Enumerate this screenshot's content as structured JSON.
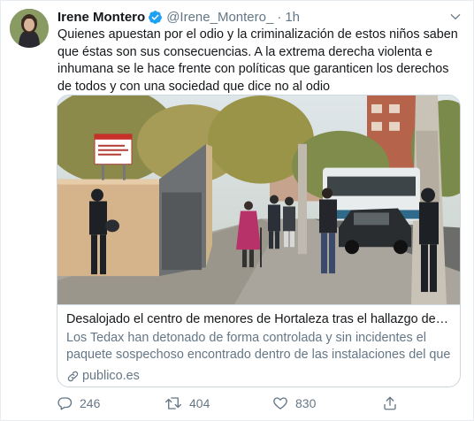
{
  "tweet": {
    "display_name": "Irene Montero",
    "handle": "@Irene_Montero_",
    "separator": "·",
    "time": "1h",
    "text": "Quienes apuestan por el odio y la criminalización de estos niños saben que éstas son sus consecuencias. A la extrema derecha violenta e inhumana se le hace frente con políticas que garanticen los derechos de todos y con una sociedad que dice no al odio"
  },
  "card": {
    "title": "Desalojado el centro de menores de Hortaleza tras el hallazgo de un art…",
    "description": "Los Tedax han detonado de forma controlada y sin incidentes el paquete sospechoso encontrado dentro de las instalaciones del que se descono…",
    "domain": "publico.es",
    "image_sign_text": "Residencia de Primera Acogida Hortaleza"
  },
  "actions": {
    "replies": "246",
    "retweets": "404",
    "likes": "830"
  },
  "icons": {
    "verified": "verified-badge-icon",
    "menu": "chevron-down-icon",
    "link": "link-icon",
    "reply": "reply-icon",
    "retweet": "retweet-icon",
    "like": "heart-icon",
    "share": "share-icon"
  },
  "colors": {
    "text_primary": "#14171a",
    "text_secondary": "#657786",
    "verified": "#1da1f2",
    "border": "#ccd6dd"
  }
}
